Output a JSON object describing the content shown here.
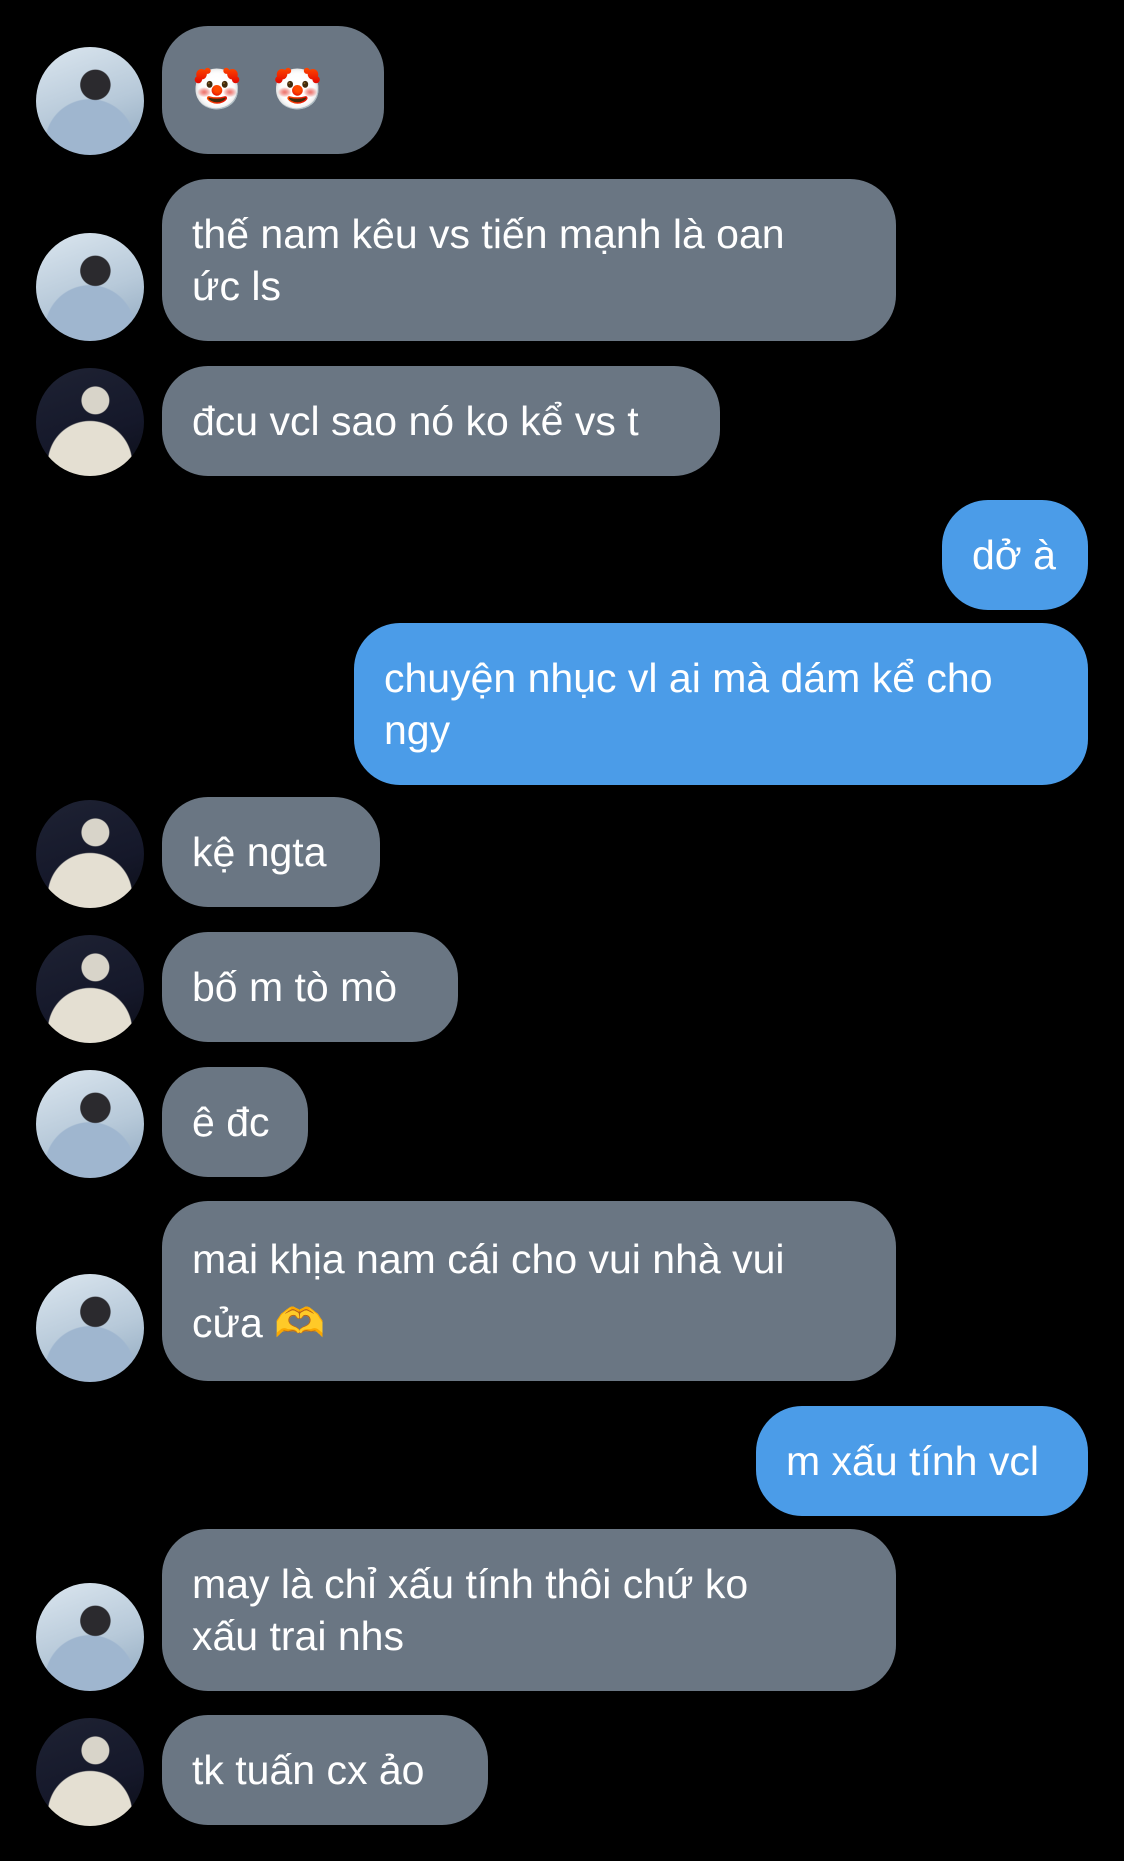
{
  "messages": [
    {
      "side": "in",
      "avatar": "a",
      "text": "🤡 🤡"
    },
    {
      "side": "in",
      "avatar": "a",
      "text": "thế nam kêu vs tiến mạnh là oan ức ls"
    },
    {
      "side": "in",
      "avatar": "b",
      "text": "đcu vcl sao nó ko kể vs t"
    },
    {
      "side": "out",
      "text": "dở à"
    },
    {
      "side": "out",
      "text": "chuyện nhục vl ai mà dám kể cho ngy"
    },
    {
      "side": "in",
      "avatar": "b",
      "text": "kệ ngta"
    },
    {
      "side": "in",
      "avatar": "b",
      "text": "bố m tò mò"
    },
    {
      "side": "in",
      "avatar": "a",
      "text": "ê đc"
    },
    {
      "side": "in",
      "avatar": "a",
      "text": "mai khịa nam cái cho vui nhà vui cửa 🫶"
    },
    {
      "side": "out",
      "text": "m xấu tính vcl"
    },
    {
      "side": "in",
      "avatar": "a",
      "text": "may là chỉ xấu tính thôi chứ ko xấu trai nhs"
    },
    {
      "side": "in",
      "avatar": "b",
      "text": "tk tuấn cx ảo"
    }
  ],
  "colors": {
    "background": "#000000",
    "incoming_bubble": "#6a7683",
    "outgoing_bubble": "#4b9ce8",
    "text": "#ffffff"
  }
}
